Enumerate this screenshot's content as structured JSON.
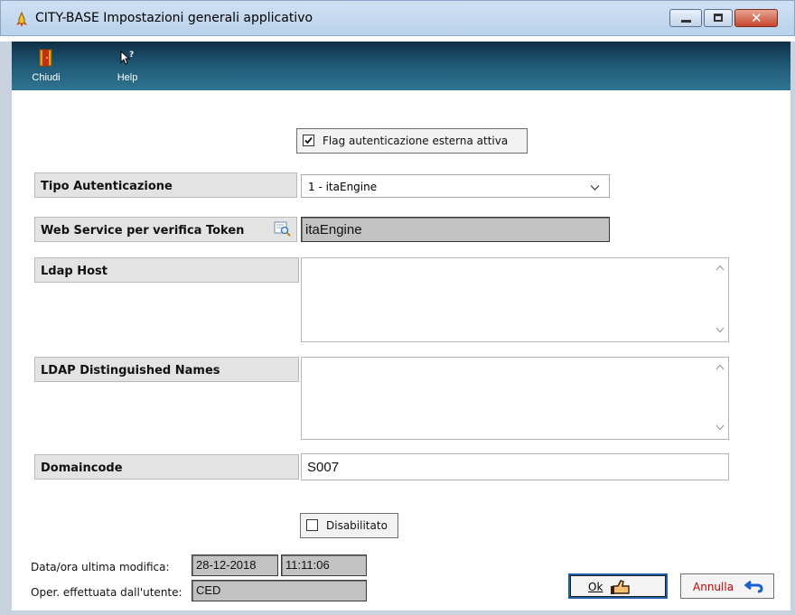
{
  "window": {
    "title": "CITY-BASE Impostazioni generali applicativo"
  },
  "toolbar": {
    "close_label": "Chiudi",
    "help_label": "Help"
  },
  "form": {
    "flag_label": "Flag autenticazione esterna attiva",
    "flag_checked": true,
    "tipo_label": "Tipo Autenticazione",
    "tipo_value": "1 - itaEngine",
    "ws_label": "Web Service per verifica Token",
    "ws_value": "itaEngine",
    "ldap_host_label": "Ldap Host",
    "ldap_host_value": "",
    "ldap_dn_label": "LDAP Distinguished Names",
    "ldap_dn_value": "",
    "domaincode_label": "Domaincode",
    "domaincode_value": "S007",
    "disabilitato_label": "Disabilitato",
    "disabilitato_checked": false
  },
  "footer": {
    "last_mod_label": "Data/ora ultima modifica:",
    "last_mod_date": "28-12-2018",
    "last_mod_time": "11:11:06",
    "user_label": "Oper. effettuata dall'utente:",
    "user_value": "CED",
    "ok_label": "Ok",
    "cancel_label": "Annulla"
  },
  "icons": {
    "app": "rocket-icon",
    "close": "door-exit-icon",
    "help": "help-pointer-icon",
    "lookup": "magnifier-icon",
    "ok": "thumbs-up-icon",
    "cancel": "undo-arrow-icon"
  },
  "colors": {
    "toolbar": "#1f5673",
    "cancel_text": "#c00000",
    "cancel_icon": "#1a5fd0"
  }
}
